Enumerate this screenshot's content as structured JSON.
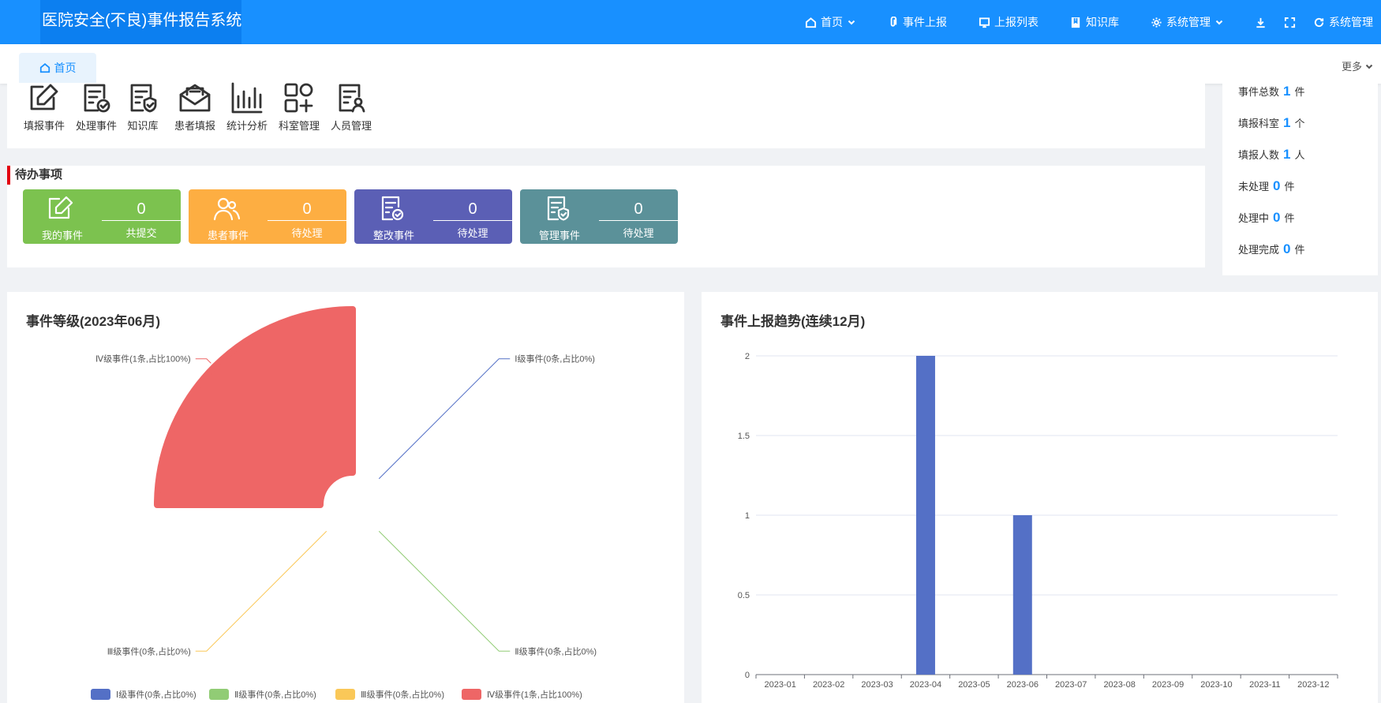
{
  "header": {
    "title": "医院安全(不良)事件报告系统",
    "nav": [
      {
        "label": "首页",
        "icon": "home-icon",
        "dropdown": true
      },
      {
        "label": "事件上报",
        "icon": "clip-icon",
        "dropdown": false
      },
      {
        "label": "上报列表",
        "icon": "monitor-icon",
        "dropdown": false
      },
      {
        "label": "知识库",
        "icon": "book-icon",
        "dropdown": false
      },
      {
        "label": "系统管理",
        "icon": "gear-icon",
        "dropdown": true
      }
    ],
    "user_label": "系统管理"
  },
  "tabs": {
    "home_label": "首页",
    "more_label": "更多"
  },
  "quick_links": [
    {
      "label": "填报事件",
      "icon": "edit-icon"
    },
    {
      "label": "处理事件",
      "icon": "doc-check-icon"
    },
    {
      "label": "知识库",
      "icon": "doc-shield-icon"
    },
    {
      "label": "患者填报",
      "icon": "mail-open-icon"
    },
    {
      "label": "统计分析",
      "icon": "bar-stats-icon"
    },
    {
      "label": "科室管理",
      "icon": "apps-add-icon"
    },
    {
      "label": "人员管理",
      "icon": "doc-user-icon"
    }
  ],
  "stats": [
    {
      "label": "事件总数",
      "value": "1",
      "unit": "件"
    },
    {
      "label": "填报科室",
      "value": "1",
      "unit": "个"
    },
    {
      "label": "填报人数",
      "value": "1",
      "unit": "人"
    },
    {
      "label": "未处理",
      "value": "0",
      "unit": "件"
    },
    {
      "label": "处理中",
      "value": "0",
      "unit": "件"
    },
    {
      "label": "处理完成",
      "value": "0",
      "unit": "件"
    }
  ],
  "todo": {
    "title": "待办事项",
    "cards": [
      {
        "label": "我的事件",
        "count": "0",
        "sub": "共提交",
        "color": "#7cc24f",
        "icon": "edit-icon"
      },
      {
        "label": "患者事件",
        "count": "0",
        "sub": "待处理",
        "color": "#fdae42",
        "icon": "users-icon"
      },
      {
        "label": "整改事件",
        "count": "0",
        "sub": "待处理",
        "color": "#5b5fb5",
        "icon": "doc-check-icon"
      },
      {
        "label": "管理事件",
        "count": "0",
        "sub": "待处理",
        "color": "#5b9199",
        "icon": "doc-shield-icon"
      }
    ]
  },
  "level_chart": {
    "title": "事件等级(2023年06月)"
  },
  "trend_chart": {
    "title": "事件上报趋势(连续12月)"
  },
  "chart_data": [
    {
      "type": "pie",
      "title": "事件等级(2023年06月)",
      "series": [
        {
          "name": "Ⅰ级事件",
          "value": 0,
          "color": "#5470c6",
          "label": "Ⅰ级事件(0条,占比0%)"
        },
        {
          "name": "Ⅱ级事件",
          "value": 0,
          "color": "#91cc75",
          "label": "Ⅱ级事件(0条,占比0%)"
        },
        {
          "name": "Ⅲ级事件",
          "value": 0,
          "color": "#fac858",
          "label": "Ⅲ级事件(0条,占比0%)"
        },
        {
          "name": "Ⅳ级事件",
          "value": 1,
          "color": "#ee6666",
          "label": "Ⅳ级事件(1条,占比100%)"
        }
      ],
      "style": "rose"
    },
    {
      "type": "bar",
      "title": "事件上报趋势(连续12月)",
      "categories": [
        "2023-01",
        "2023-02",
        "2023-03",
        "2023-04",
        "2023-05",
        "2023-06",
        "2023-07",
        "2023-08",
        "2023-09",
        "2023-10",
        "2023-11",
        "2023-12"
      ],
      "values": [
        0,
        0,
        0,
        2,
        0,
        1,
        0,
        0,
        0,
        0,
        0,
        0
      ],
      "ylim": [
        0,
        2
      ],
      "yticks": [
        "0",
        "0.5",
        "1",
        "1.5",
        "2"
      ],
      "color": "#5470c6",
      "grid": true
    }
  ]
}
